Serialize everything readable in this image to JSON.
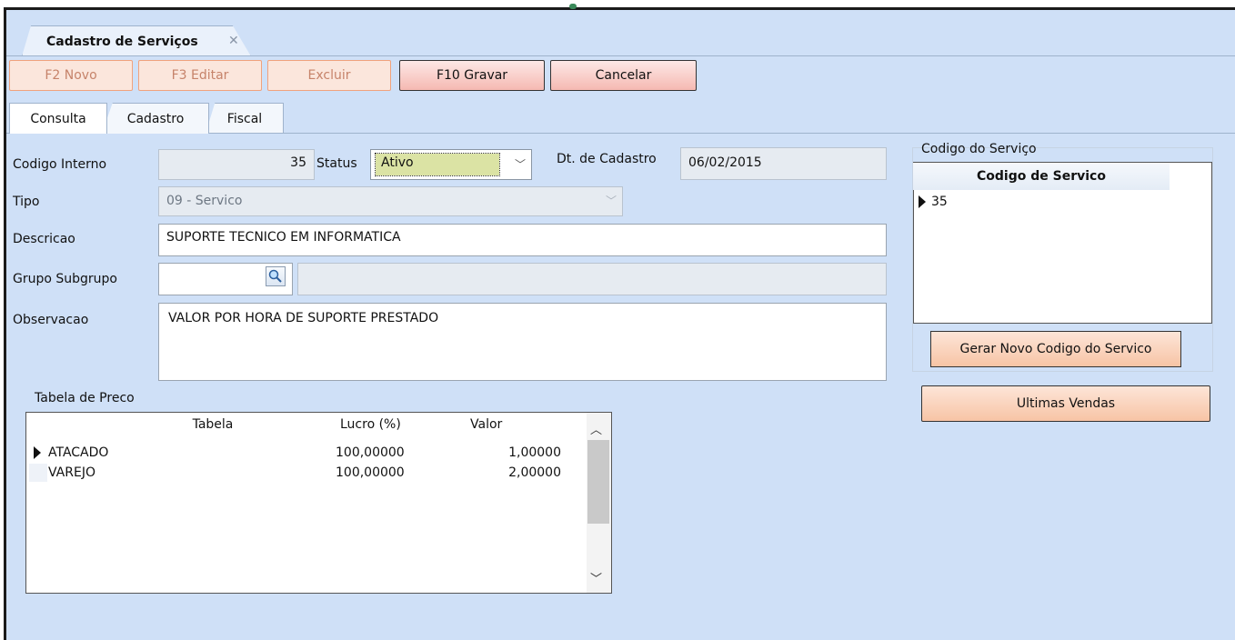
{
  "window": {
    "tab_title": "Cadastro de Serviços"
  },
  "toolbar": {
    "novo": "F2 Novo",
    "editar": "F3 Editar",
    "excluir": "Excluir",
    "gravar": "F10 Gravar",
    "cancelar": "Cancelar"
  },
  "tabs": [
    "Consulta",
    "Cadastro",
    "Fiscal"
  ],
  "form": {
    "codigo_interno_label": "Codigo Interno",
    "codigo_interno_value": "35",
    "status_label": "Status",
    "status_value": "Ativo",
    "dt_cadastro_label": "Dt. de Cadastro",
    "dt_cadastro_value": "06/02/2015",
    "tipo_label": "Tipo",
    "tipo_value": "09 - Servico",
    "descricao_label": "Descricao",
    "descricao_value": "SUPORTE TECNICO EM INFORMATICA",
    "grupo_label": "Grupo Subgrupo",
    "grupo_value": "",
    "grupo_desc_value": "",
    "observacao_label": "Observacao",
    "observacao_value": "VALOR POR HORA DE SUPORTE PRESTADO"
  },
  "preco": {
    "group_label": "Tabela de Preco",
    "columns": [
      "Tabela",
      "Lucro (%)",
      "Valor"
    ],
    "rows": [
      {
        "tabela": "ATACADO",
        "lucro": "100,00000",
        "valor": "1,00000"
      },
      {
        "tabela": "VAREJO",
        "lucro": "100,00000",
        "valor": "2,00000"
      }
    ]
  },
  "codigo_servico": {
    "group_label": "Codigo do Serviço",
    "column": "Codigo de Servico",
    "rows": [
      "35"
    ],
    "gerar_button": "Gerar Novo Codigo do Servico"
  },
  "ultimas_vendas_button": "Ultimas Vendas",
  "icons": {
    "close": "close-icon",
    "dropdown": "chevron-down-icon",
    "search": "search-icon",
    "row_pointer": "row-pointer-icon"
  }
}
